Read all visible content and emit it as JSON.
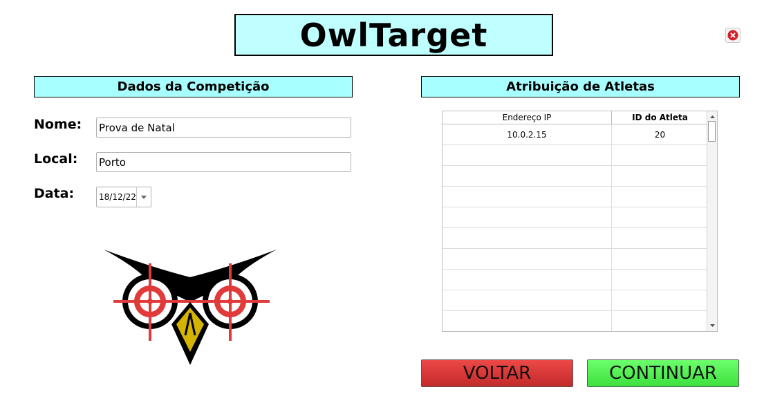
{
  "app": {
    "title": "OwlTarget"
  },
  "window": {
    "close_icon": "close-icon"
  },
  "competition": {
    "heading": "Dados da Competição",
    "name_label": "Nome:",
    "name_value": "Prova de Natal",
    "location_label": "Local:",
    "location_value": "Porto",
    "date_label": "Data:",
    "date_value": "18/12/22"
  },
  "athletes": {
    "heading": "Atribuição de Atletas",
    "columns": [
      "Endereço IP",
      "ID do Atleta"
    ],
    "rows": [
      [
        "10.0.2.15",
        "20"
      ],
      [
        "",
        ""
      ],
      [
        "",
        ""
      ],
      [
        "",
        ""
      ],
      [
        "",
        ""
      ],
      [
        "",
        ""
      ],
      [
        "",
        ""
      ],
      [
        "",
        ""
      ],
      [
        "",
        ""
      ],
      [
        "",
        ""
      ]
    ]
  },
  "actions": {
    "back_label": "VOLTAR",
    "continue_label": "CONTINUAR"
  },
  "colors": {
    "header_bg": "#a8ffff",
    "back_btn": "#e03a3a",
    "continue_btn": "#55f055",
    "owl_red": "#e03a3a",
    "owl_gold": "#d4b400"
  }
}
